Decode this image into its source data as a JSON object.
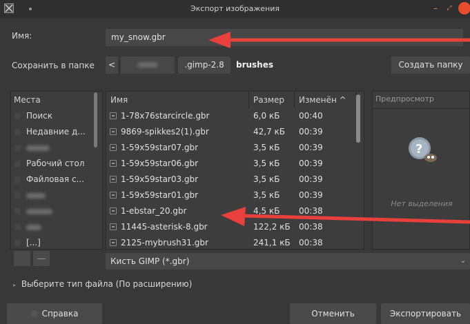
{
  "window": {
    "title": "Экспорт изображения",
    "minimize": "–",
    "maximize": "⤢"
  },
  "name_row": {
    "label": "Имя:",
    "value": "my_snow.gbr"
  },
  "folder_row": {
    "label": "Сохранить в папке",
    "back": "<",
    "crumbs": [
      ".gimp-2.8",
      "brushes"
    ],
    "create_folder": "Создать папку"
  },
  "places": {
    "header": "Места",
    "items": [
      "Поиск",
      "Недавние д...",
      "",
      "Рабочий стол",
      "Файловая с...",
      "",
      "",
      "",
      "[...]"
    ]
  },
  "files": {
    "columns": [
      "Имя",
      "Размер",
      "Изменён ^"
    ],
    "rows": [
      {
        "name": "1-78x76starcircle.gbr",
        "size": "6,0 кБ",
        "modified": "00:40"
      },
      {
        "name": "9869-spikkes2(1).gbr",
        "size": "42,7 кБ",
        "modified": "00:39"
      },
      {
        "name": "1-59x59star07.gbr",
        "size": "3,5 кБ",
        "modified": "00:39"
      },
      {
        "name": "1-59x59star06.gbr",
        "size": "3,5 кБ",
        "modified": "00:39"
      },
      {
        "name": "1-59x59star03.gbr",
        "size": "3,5 кБ",
        "modified": "00:39"
      },
      {
        "name": "1-59x59star01.gbr",
        "size": "3,5 кБ",
        "modified": "00:39"
      },
      {
        "name": "1-ebstar_20.gbr",
        "size": "4,5 кБ",
        "modified": "00:38"
      },
      {
        "name": "11445-asterisk-8.gbr",
        "size": "122,2 кБ",
        "modified": "00:38"
      },
      {
        "name": "2125-mybrush31.gbr",
        "size": "241,1 кБ",
        "modified": "00:38"
      }
    ]
  },
  "preview": {
    "title": "Предпросмотр",
    "empty": "Нет выделения"
  },
  "filter": {
    "value": "Кисть GIMP (*.gbr)"
  },
  "filetype": {
    "label": "Выберите тип файла (По расширению)"
  },
  "buttons": {
    "help": "Справка",
    "cancel": "Отменить",
    "export": "Экспортировать",
    "remove_place": "—"
  },
  "colors": {
    "annotation_arrow": "#e8403a",
    "background": "#383838",
    "field": "#474747"
  }
}
